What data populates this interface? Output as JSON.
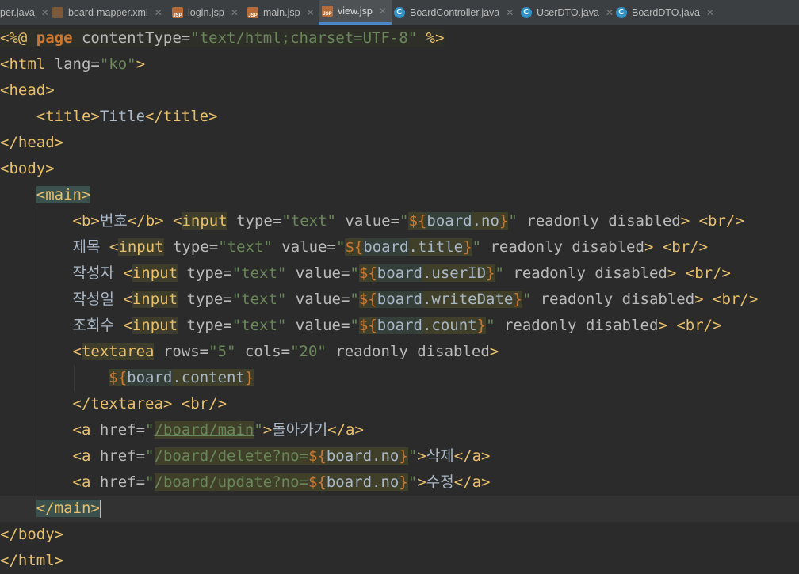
{
  "tabs": [
    {
      "label": "per.java",
      "type": "java",
      "active": false
    },
    {
      "label": "board-mapper.xml",
      "type": "xml",
      "active": false
    },
    {
      "label": "login.jsp",
      "type": "jsp",
      "active": false
    },
    {
      "label": "main.jsp",
      "type": "jsp",
      "active": false
    },
    {
      "label": "view.jsp",
      "type": "jsp",
      "active": true
    },
    {
      "label": "BoardController.java",
      "type": "cls",
      "active": false
    },
    {
      "label": "UserDTO.java",
      "type": "cls",
      "active": false
    },
    {
      "label": "BoardDTO.java",
      "type": "cls",
      "active": false
    }
  ],
  "close_glyph": "✕",
  "code": {
    "l1": {
      "a": "<%@ ",
      "b": "page",
      "c": " contentType=",
      "d": "\"text/html;charset=UTF-8\"",
      "e": " %>"
    },
    "l2": {
      "a": "<html ",
      "b": "lang=",
      "c": "\"ko\"",
      "d": ">"
    },
    "l3": {
      "a": "<head>"
    },
    "l4": {
      "a": "<title>",
      "b": "Title",
      "c": "</title>"
    },
    "l5": {
      "a": "</head>"
    },
    "l6": {
      "a": "<body>"
    },
    "l7": {
      "a": "<main>"
    },
    "l8": {
      "a": "<b>",
      "b": "번호",
      "c": "</b>",
      "d": " <",
      "e": "input",
      "f": " type=",
      "g": "\"text\"",
      "h": " value=",
      "i": "\"",
      "j": "${",
      "k": "board",
      "l": ".no",
      "m": "}",
      "n": "\"",
      "o": " readonly disabled",
      "p": "> ",
      "q": "<br/>"
    },
    "l9": {
      "a": "제목 ",
      "b": "<",
      "c": "input",
      "d": " type=",
      "e": "\"text\"",
      "f": " value=",
      "g": "\"",
      "h": "${",
      "i": "board",
      "j": ".title",
      "k": "}",
      "l": "\"",
      "m": " readonly disabled",
      "n": "> ",
      "o": "<br/>"
    },
    "l10": {
      "a": "작성자 ",
      "b": "<",
      "c": "input",
      "d": " type=",
      "e": "\"text\"",
      "f": " value=",
      "g": "\"",
      "h": "${",
      "i": "board",
      "j": ".userID",
      "k": "}",
      "l": "\"",
      "m": " readonly disabled",
      "n": "> ",
      "o": "<br/>"
    },
    "l11": {
      "a": "작성일 ",
      "b": "<",
      "c": "input",
      "d": " type=",
      "e": "\"text\"",
      "f": " value=",
      "g": "\"",
      "h": "${",
      "i": "board",
      "j": ".writeDate",
      "k": "}",
      "l": "\"",
      "m": " readonly disabled",
      "n": "> ",
      "o": "<br/>"
    },
    "l12": {
      "a": "조회수 ",
      "b": "<",
      "c": "input",
      "d": " type=",
      "e": "\"text\"",
      "f": " value=",
      "g": "\"",
      "h": "${",
      "i": "board",
      "j": ".count",
      "k": "}",
      "l": "\"",
      "m": " readonly disabled",
      "n": "> ",
      "o": "<br/>"
    },
    "l13": {
      "a": "<",
      "b": "textarea",
      "c": " rows=",
      "d": "\"5\"",
      "e": " cols=",
      "f": "\"20\"",
      "g": " readonly disabled",
      "h": ">"
    },
    "l14": {
      "a": "${",
      "b": "board",
      "c": ".content",
      "d": "}"
    },
    "l15": {
      "a": "</textarea>",
      "b": " ",
      "c": "<br/>"
    },
    "l16": {
      "a": "<a ",
      "b": "href=",
      "c": "\"",
      "d": "/board/main",
      "e": "\"",
      "f": ">",
      "g": "돌아가기",
      "h": "</a>"
    },
    "l17": {
      "a": "<a ",
      "b": "href=",
      "c": "\"",
      "d": "/board/delete?no=",
      "e": "${",
      "f": "board.no",
      "g": "}",
      "h": "\"",
      "i": ">",
      "j": "삭제",
      "k": "</a>"
    },
    "l18": {
      "a": "<a ",
      "b": "href=",
      "c": "\"",
      "d": "/board/update?no=",
      "e": "${",
      "f": "board.no",
      "g": "}",
      "h": "\"",
      "i": ">",
      "j": "수정",
      "k": "</a>"
    },
    "l19": {
      "a": "</main>"
    },
    "l20": {
      "a": "</body>"
    },
    "l21": {
      "a": "</html>"
    }
  }
}
